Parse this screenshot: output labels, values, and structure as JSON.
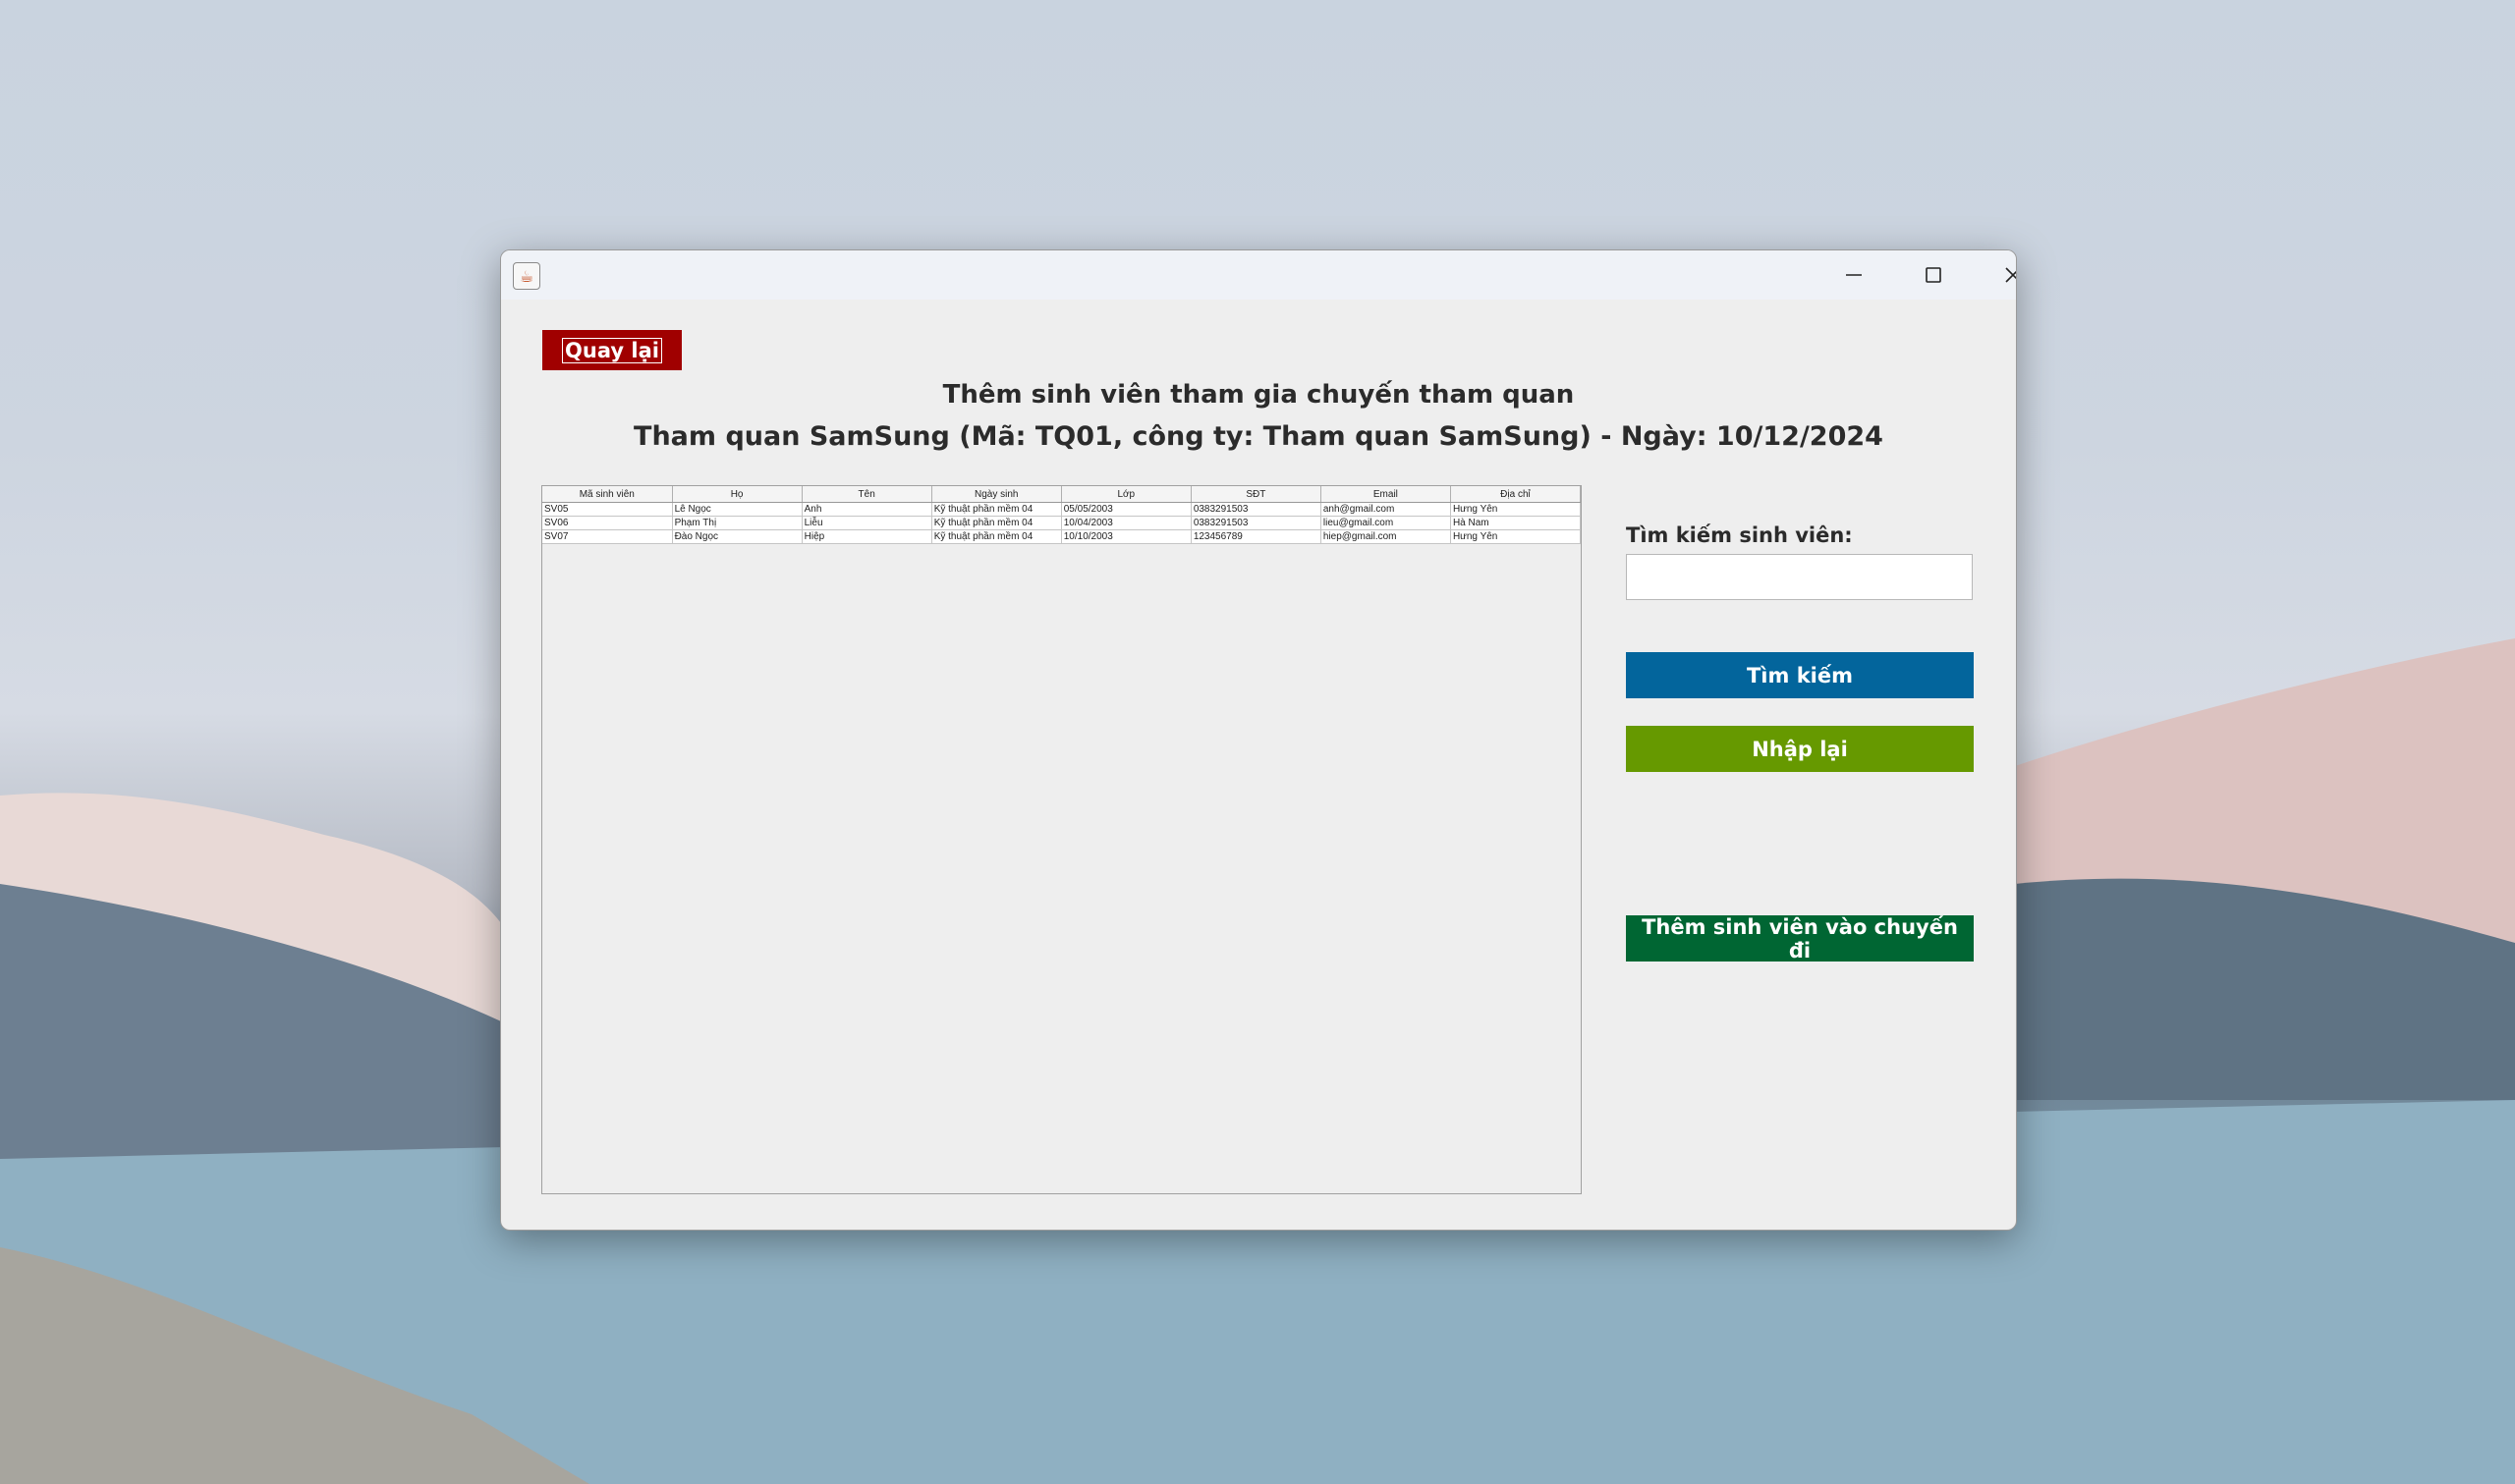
{
  "colors": {
    "back_button": "#a00000",
    "search_button": "#03659c",
    "reset_button": "#669900",
    "add_button": "#006633"
  },
  "window": {
    "app_icon": "java-icon",
    "controls": [
      "minimize-icon",
      "maximize-icon",
      "close-icon"
    ]
  },
  "header": {
    "back_label": "Quay lại",
    "title": "Thêm sinh viên tham gia chuyến tham quan",
    "subtitle": "Tham quan SamSung (Mã: TQ01, công ty: Tham quan SamSung) - Ngày: 10/12/2024"
  },
  "table": {
    "columns": [
      "Mã sinh viên",
      "Họ",
      "Tên",
      "Ngày sinh",
      "Lớp",
      "SĐT",
      "Email",
      "Địa chỉ"
    ],
    "rows": [
      [
        "SV05",
        "Lê Ngọc",
        "Anh",
        "Kỹ thuật phần mềm 04",
        "05/05/2003",
        "0383291503",
        "anh@gmail.com",
        "Hưng Yên"
      ],
      [
        "SV06",
        "Phạm Thị",
        "Liễu",
        "Kỹ thuật phần mềm 04",
        "10/04/2003",
        "0383291503",
        "lieu@gmail.com",
        "Hà Nam"
      ],
      [
        "SV07",
        "Đào Ngọc",
        "Hiệp",
        "Kỹ thuật phần mềm 04",
        "10/10/2003",
        "123456789",
        "hiep@gmail.com",
        "Hưng Yên"
      ]
    ]
  },
  "search": {
    "label": "Tìm kiếm sinh viên:",
    "value": "",
    "search_button": "Tìm kiếm",
    "reset_button": "Nhập lại"
  },
  "actions": {
    "add_button": "Thêm sinh viên vào chuyến đi"
  }
}
